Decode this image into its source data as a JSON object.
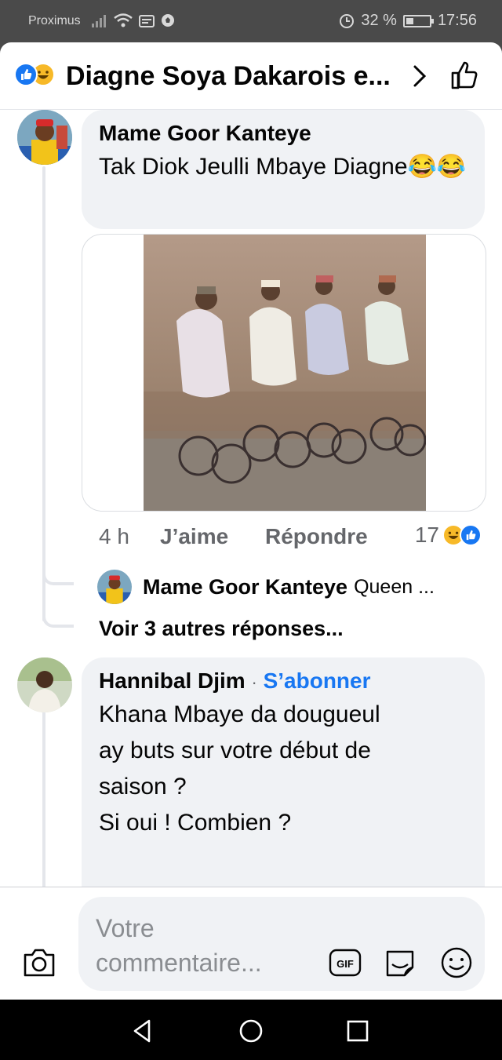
{
  "status_bar": {
    "carrier": "Proximus",
    "battery_level": "32 %",
    "battery_fraction": 0.32,
    "time": "17:56"
  },
  "header": {
    "title": "Diagne Soya Dakarois e..."
  },
  "comments": [
    {
      "author": "Mame Goor Kanteye",
      "text": "Tak Diok Jeulli Mbaye Diagne😂😂",
      "time": "4 h",
      "like_label": "J’aime",
      "reply_label": "Répondre",
      "reaction_count": "17"
    },
    {
      "author": "Hannibal Djim",
      "separator": "·",
      "follow_label": "S’abonner",
      "text_lines": [
        "Khana Mbaye da dougueul",
        "ay buts sur votre début de",
        "saison ?",
        "Si oui ! Combien ?"
      ]
    }
  ],
  "reply_preview": {
    "author": "Mame Goor Kanteye",
    "text": "Queen ..."
  },
  "more_replies": "Voir 3 autres réponses...",
  "composer": {
    "placeholder": "Votre commentaire..."
  },
  "icons": {
    "like": "like-reaction-icon",
    "haha": "haha-reaction-icon",
    "camera": "camera-icon",
    "gif": "gif-icon",
    "sticker": "sticker-icon",
    "emoji": "emoji-icon"
  },
  "colors": {
    "brand_blue": "#1877f2",
    "bubble": "#f0f2f5",
    "haha_yellow": "#f7b928"
  }
}
